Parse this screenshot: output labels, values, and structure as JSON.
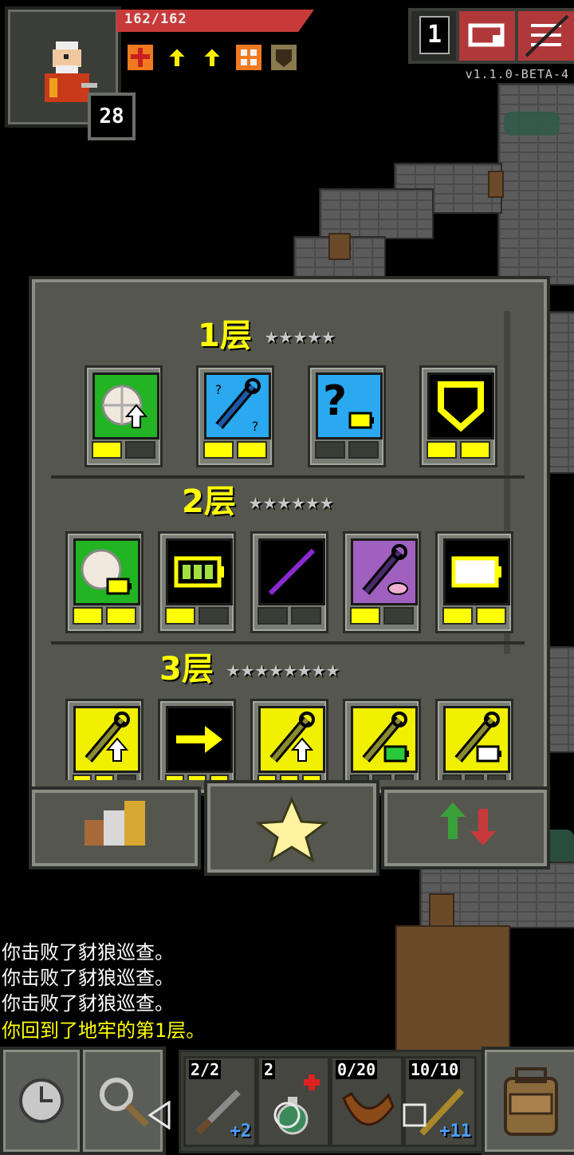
{
  "hud": {
    "hp_text": "162/162",
    "hp_fraction": 1.0,
    "level": "28",
    "depth_indicator": "1",
    "version": "v1.1.0-BETA-4",
    "buffs": [
      "red-cross-icon",
      "yellow-arrow-up-icon",
      "yellow-arrow-up-icon",
      "orange-shield-icon",
      "brown-badge-icon"
    ],
    "buttons": [
      "journal-button",
      "menu-button"
    ]
  },
  "talents_panel": {
    "tiers": [
      {
        "title": "1层",
        "stars": "★★★★★",
        "talents": [
          {
            "icon": "food-upgrade-icon",
            "color": "#22b422",
            "points": 1,
            "max": 2
          },
          {
            "icon": "blue-wand-icon",
            "color": "#2aa8f0",
            "points": 2,
            "max": 2
          },
          {
            "icon": "identify-key-icon",
            "color": "#2aa8f0",
            "points": 0,
            "max": 2
          },
          {
            "icon": "shield-icon",
            "color": "#000000",
            "points": 2,
            "max": 2
          }
        ]
      },
      {
        "title": "2层",
        "stars": "★★★★★★",
        "talents": [
          {
            "icon": "food-battery-icon",
            "color": "#22b422",
            "points": 2,
            "max": 2
          },
          {
            "icon": "battery-full-icon",
            "color": "#000000",
            "points": 1,
            "max": 2
          },
          {
            "icon": "purple-staff-icon",
            "color": "#000000",
            "points": 0,
            "max": 2
          },
          {
            "icon": "purple-wand-icon",
            "color": "#a060c0",
            "points": 1,
            "max": 2
          },
          {
            "icon": "battery-empty-icon",
            "color": "#000000",
            "points": 2,
            "max": 2
          }
        ]
      },
      {
        "title": "3层",
        "stars": "★★★★★★★★",
        "talents": [
          {
            "icon": "wand-upgrade-icon",
            "color": "#f0f000",
            "points": 2,
            "max": 3
          },
          {
            "icon": "arrow-right-icon",
            "color": "#000000",
            "points": 3,
            "max": 3
          },
          {
            "icon": "wand-upgrade-icon",
            "color": "#f0f000",
            "points": 3,
            "max": 3
          },
          {
            "icon": "wand-green-battery-icon",
            "color": "#f0f000",
            "points": 0,
            "max": 3
          },
          {
            "icon": "wand-battery-icon",
            "color": "#f0f000",
            "points": 0,
            "max": 3
          }
        ]
      }
    ],
    "tabs": [
      "stats-tab-icon",
      "star-tab-icon",
      "swap-tab-icon"
    ]
  },
  "log": [
    {
      "text": "你击败了豺狼巡查。",
      "color": "#ffffff"
    },
    {
      "text": "你击败了豺狼巡查。",
      "color": "#ffffff"
    },
    {
      "text": "你击败了豺狼巡查。",
      "color": "#ffffff"
    },
    {
      "text": "你回到了地牢的第1层。",
      "color": "#ffff00"
    }
  ],
  "quickslots": [
    {
      "label": "2/2",
      "plus": "+2",
      "icon": "dart-icon"
    },
    {
      "label": "2",
      "plus": "",
      "icon": "potion-icon"
    },
    {
      "label": "0/20",
      "plus": "",
      "icon": "horn-icon"
    },
    {
      "label": "10/10",
      "plus": "+11",
      "icon": "wand-icon"
    }
  ]
}
